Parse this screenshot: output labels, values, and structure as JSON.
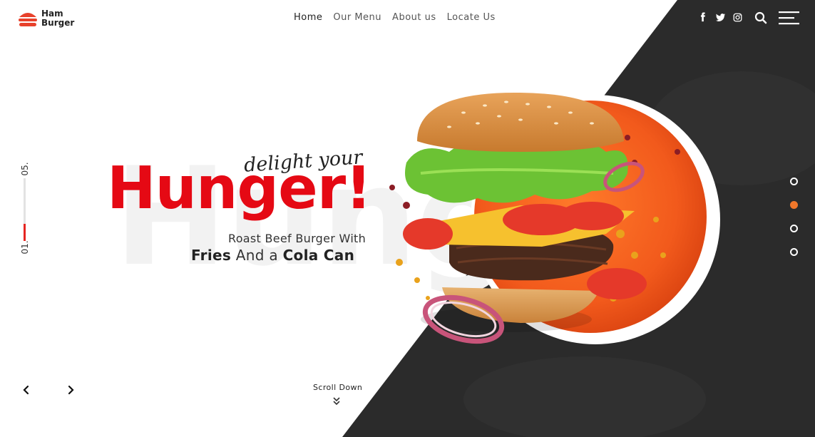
{
  "brand": {
    "line1": "Ham",
    "line2": "Burger",
    "accent_color": "#e8412b"
  },
  "nav": {
    "items": [
      {
        "label": "Home",
        "active": true
      },
      {
        "label": "Our Menu",
        "active": false
      },
      {
        "label": "About us",
        "active": false
      },
      {
        "label": "Locate Us",
        "active": false
      }
    ]
  },
  "header_icons": [
    "facebook-icon",
    "twitter-icon",
    "instagram-icon",
    "search-icon",
    "menu-icon"
  ],
  "slide_counter": {
    "current": "01.",
    "total": "05.",
    "progress": 0.2
  },
  "hero": {
    "ghost_text": "Hung",
    "script_line": "delight your",
    "headline": "Hunger!",
    "subtitle": "Roast Beef Burger With",
    "tagline_bold1": "Fries",
    "tagline_mid": " And a ",
    "tagline_bold2": "Cola Can"
  },
  "scroll": {
    "label": "Scroll Down"
  },
  "slides": {
    "count": 4,
    "active_index": 1
  },
  "colors": {
    "headline": "#e50914",
    "dark_panel": "#2c2c2c",
    "orange": "#f0772a"
  }
}
